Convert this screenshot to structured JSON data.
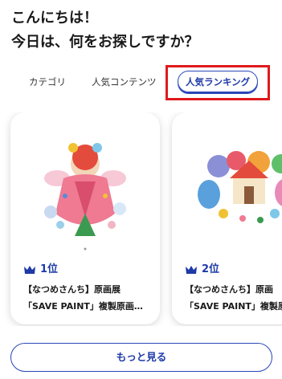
{
  "greeting": {
    "line1": "こんにちは！",
    "line2": "今日は、何をお探しですか？"
  },
  "tabs": [
    {
      "label": "カテゴリ",
      "selected": false
    },
    {
      "label": "人気コンテンツ",
      "selected": false
    },
    {
      "label": "人気ランキング",
      "selected": true
    }
  ],
  "accent_color": "#1d3aa8",
  "highlight_color": "#e0191b",
  "cards": [
    {
      "rank": "1位",
      "title_line1": "【なつめさんち】原画展",
      "title_line2": "「SAVE PAINT」複製原画…",
      "thumb_icon": "artwork-image-icon"
    },
    {
      "rank": "2位",
      "title_line1": "【なつめさんち】原画",
      "title_line2": "「SAVE PAINT」複製原",
      "thumb_icon": "artwork-image-icon"
    }
  ],
  "more_button": "もっと見る"
}
